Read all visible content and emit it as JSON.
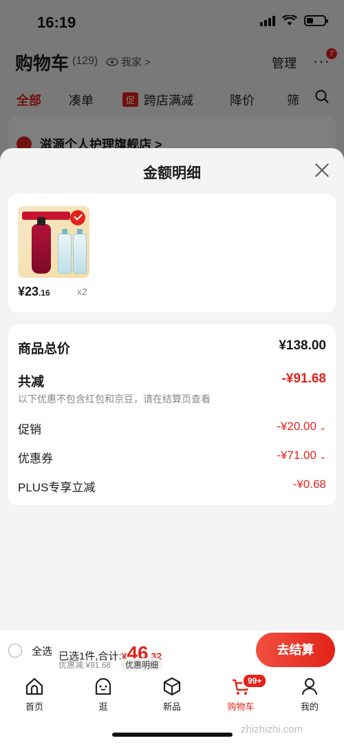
{
  "status_bar": {
    "time": "16:19"
  },
  "cart_header": {
    "title": "购物车",
    "count": "(129)",
    "location": "我家 >",
    "manage_label": "管理",
    "more_label": "···",
    "more_badge": "7"
  },
  "filter_tabs": {
    "all": "全部",
    "bundle": "凑单",
    "promo_tag": "促",
    "cross_store": "跨店满减",
    "price_drop": "降价",
    "filter": "筛"
  },
  "store": {
    "name": "滋源个人护理旗舰店 >"
  },
  "sheet": {
    "title": "金额明细",
    "product": {
      "price_int": "¥23",
      "price_dec": ".16",
      "quantity": "x2"
    },
    "summary": {
      "total_label": "商品总价",
      "total_value": "¥138.00",
      "reduce_label": "共减",
      "reduce_value": "-¥91.68",
      "note": "以下优惠不包含红包和京豆，请在结算页查看",
      "promo_label": "促销",
      "promo_value": "-¥20.00",
      "coupon_label": "优惠券",
      "coupon_value": "-¥71.00",
      "plus_label": "PLUS专享立减",
      "plus_value": "-¥0.68"
    }
  },
  "checkout": {
    "select_all": "全选",
    "selected_prefix": "已选1件,合计:",
    "currency": "¥",
    "total_int": "46",
    "total_dec": ".32",
    "discount": "优惠减:¥91.68",
    "detail_label": "优惠明细",
    "button_label": "去结算"
  },
  "tab_bar": {
    "home": "首页",
    "browse": "逛",
    "new": "新品",
    "cart": "购物车",
    "cart_badge": "99+",
    "me": "我的"
  },
  "watermark": "zhizhizhi.com",
  "colors": {
    "accent": "#e2231a"
  }
}
